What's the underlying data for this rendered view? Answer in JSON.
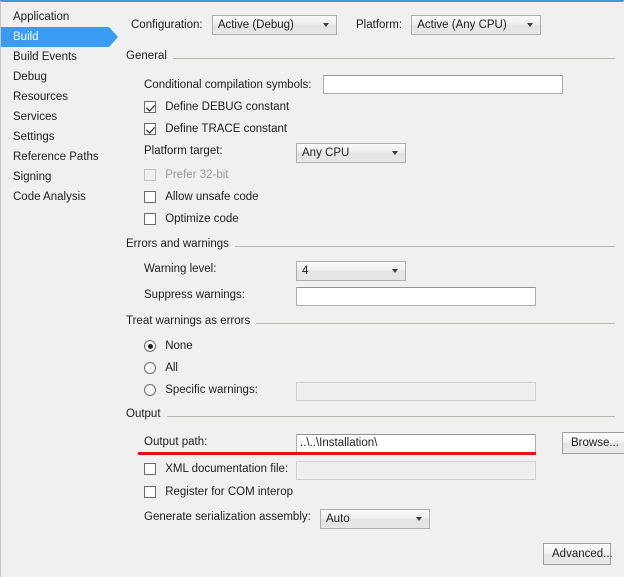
{
  "window": {
    "title": "Build",
    "accent_color": "#3a9bf4",
    "top_border_color": "#3a99d9",
    "background_color": "#f0f0f0",
    "annotation_color": "#ee1111"
  },
  "sidebar": {
    "items": [
      {
        "label": "Application",
        "selected": false
      },
      {
        "label": "Build",
        "selected": true
      },
      {
        "label": "Build Events",
        "selected": false
      },
      {
        "label": "Debug",
        "selected": false
      },
      {
        "label": "Resources",
        "selected": false
      },
      {
        "label": "Services",
        "selected": false
      },
      {
        "label": "Settings",
        "selected": false
      },
      {
        "label": "Reference Paths",
        "selected": false
      },
      {
        "label": "Signing",
        "selected": false
      },
      {
        "label": "Code Analysis",
        "selected": false
      }
    ]
  },
  "config_row": {
    "configuration_label": "Configuration:",
    "configuration_value": "Active (Debug)",
    "platform_label": "Platform:",
    "platform_value": "Active (Any CPU)"
  },
  "general": {
    "group_title": "General",
    "conditional_symbols_label": "Conditional compilation symbols:",
    "conditional_symbols_value": "",
    "define_debug_label": "Define DEBUG constant",
    "define_debug_checked": true,
    "define_trace_label": "Define TRACE constant",
    "define_trace_checked": true,
    "platform_target_label": "Platform target:",
    "platform_target_value": "Any CPU",
    "prefer_32bit_label": "Prefer 32-bit",
    "prefer_32bit_checked": false,
    "prefer_32bit_disabled": true,
    "allow_unsafe_label": "Allow unsafe code",
    "allow_unsafe_checked": false,
    "optimize_code_label": "Optimize code",
    "optimize_code_checked": false
  },
  "errors_warnings": {
    "group_title": "Errors and warnings",
    "warning_level_label": "Warning level:",
    "warning_level_value": "4",
    "suppress_warnings_label": "Suppress warnings:",
    "suppress_warnings_value": ""
  },
  "treat_warnings": {
    "group_title": "Treat warnings as errors",
    "none_label": "None",
    "none_selected": true,
    "all_label": "All",
    "all_selected": false,
    "specific_label": "Specific warnings:",
    "specific_selected": false,
    "specific_value": "",
    "specific_disabled": true
  },
  "output": {
    "group_title": "Output",
    "output_path_label": "Output path:",
    "output_path_value": "..\\..\\Installation\\",
    "browse_label": "Browse...",
    "xml_doc_label": "XML documentation file:",
    "xml_doc_checked": false,
    "xml_doc_value": "",
    "xml_doc_disabled": true,
    "com_interop_label": "Register for COM interop",
    "com_interop_checked": false,
    "serialization_label": "Generate serialization assembly:",
    "serialization_value": "Auto"
  },
  "footer": {
    "advanced_label": "Advanced..."
  }
}
